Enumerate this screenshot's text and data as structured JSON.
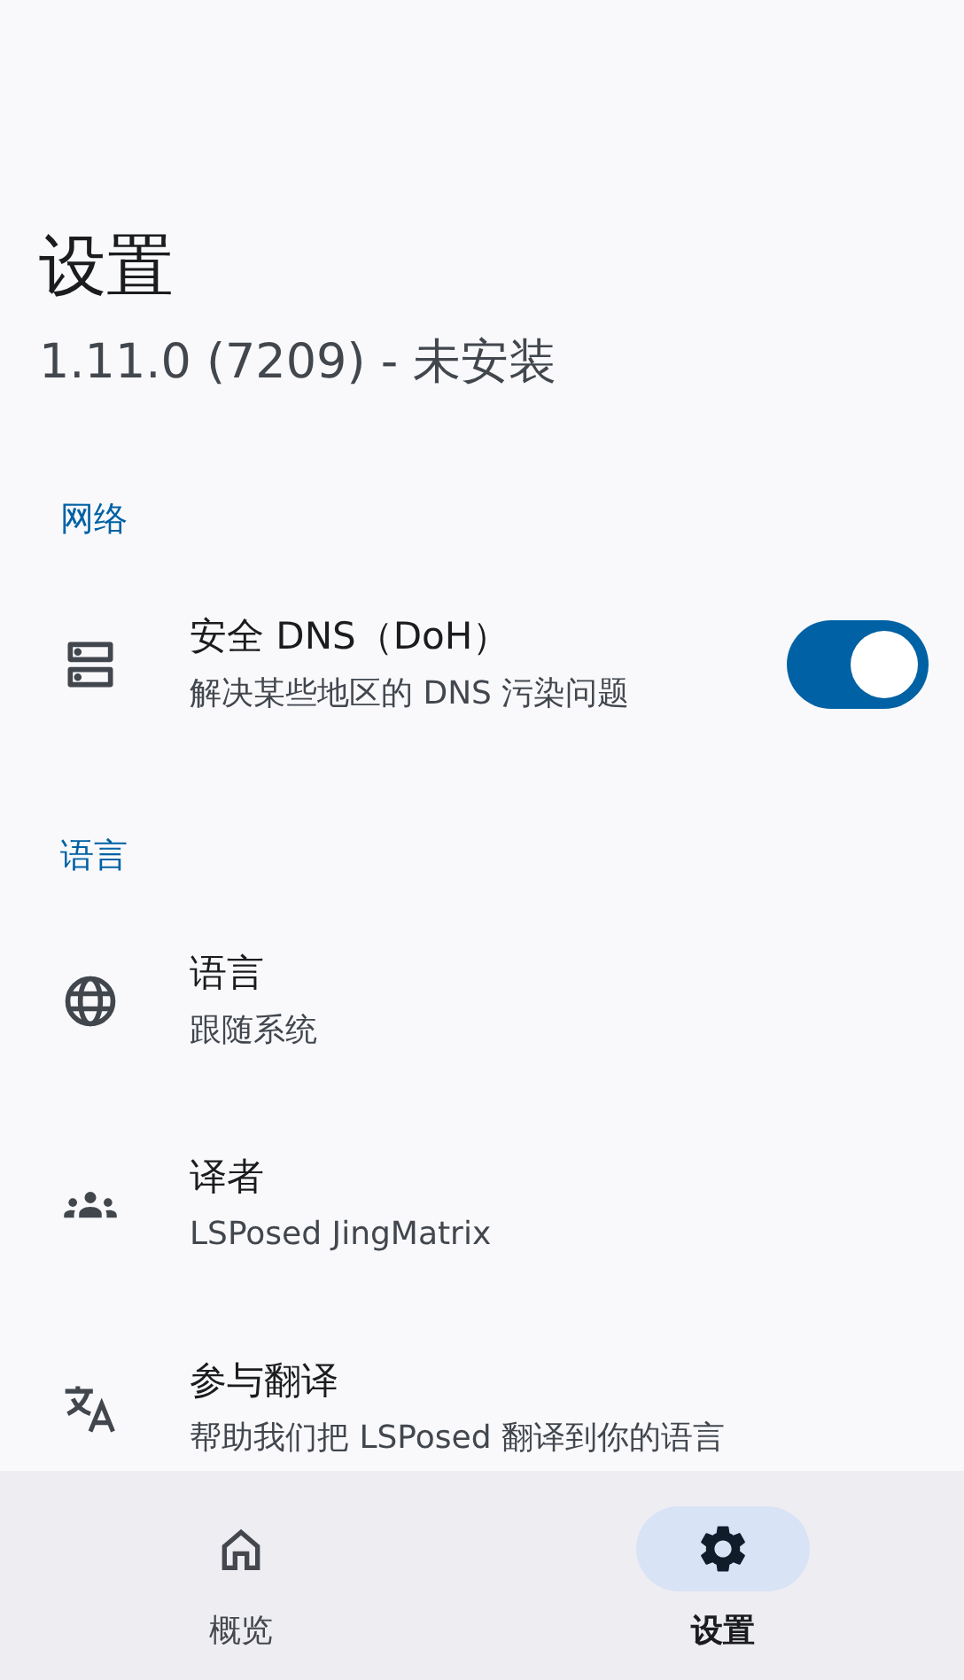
{
  "header": {
    "title": "设置",
    "version": "1.11.0 (7209) - 未安装"
  },
  "sections": [
    {
      "title": "网络",
      "items": [
        {
          "kind": "switch",
          "title": "安全 DNS（DoH）",
          "subtitle": "解决某些地区的 DNS 污染问题",
          "on": true
        }
      ]
    },
    {
      "title": "语言",
      "items": [
        {
          "kind": "plain",
          "title": "语言",
          "subtitle": "跟随系统"
        },
        {
          "kind": "plain",
          "title": "译者",
          "subtitle": "LSPosed JingMatrix"
        },
        {
          "kind": "plain",
          "title": "参与翻译",
          "subtitle": "帮助我们把 LSPosed 翻译到你的语言"
        }
      ]
    }
  ],
  "nav": [
    {
      "label": "概览",
      "selected": false
    },
    {
      "label": "设置",
      "selected": true
    }
  ]
}
